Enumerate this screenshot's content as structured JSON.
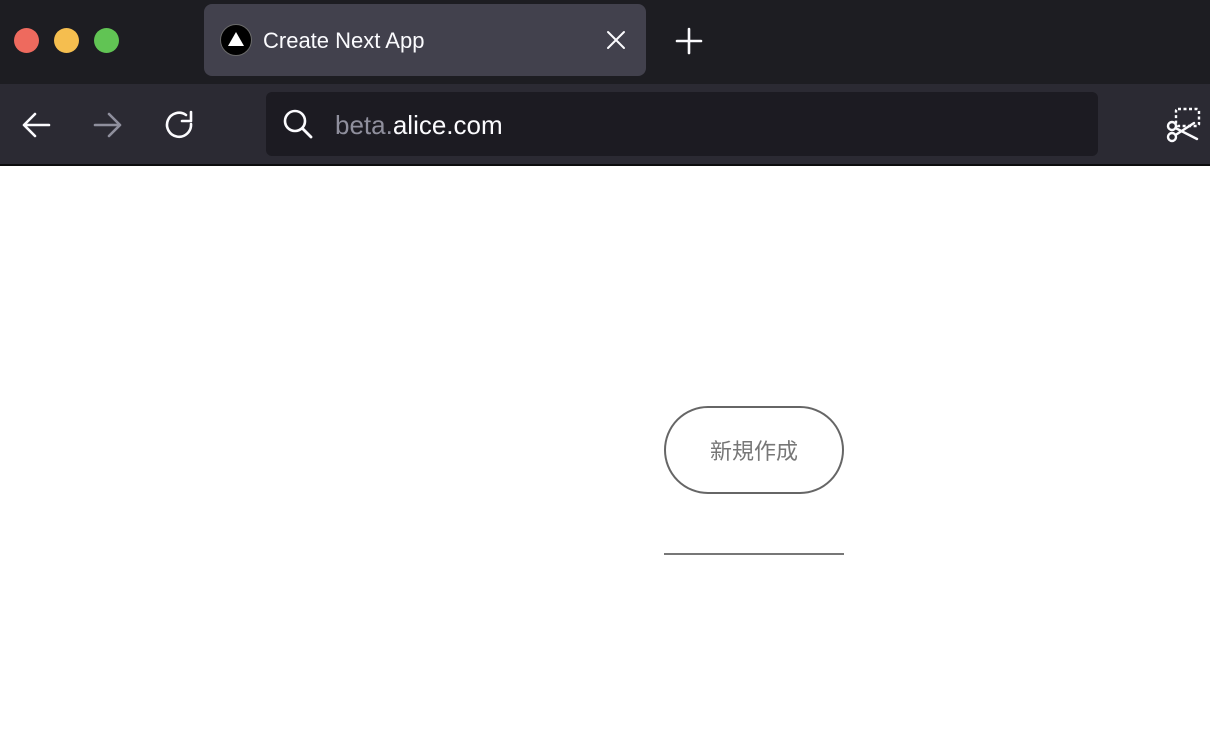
{
  "window": {
    "controls": [
      "close",
      "minimize",
      "maximize"
    ],
    "colors": {
      "close": "#ee6a5e",
      "minimize": "#f5be4f",
      "maximize": "#61c454"
    }
  },
  "tabs": [
    {
      "title": "Create Next App",
      "favicon": "nextjs-triangle-icon",
      "active": true
    }
  ],
  "toolbar": {
    "icons": [
      "back-arrow-icon",
      "forward-arrow-icon",
      "reload-icon",
      "screenshot-scissors-icon"
    ]
  },
  "urlbar": {
    "subdomain": "beta.",
    "domain": "alice.com",
    "icon": "search-icon"
  },
  "page": {
    "create_button_label": "新規作成"
  }
}
